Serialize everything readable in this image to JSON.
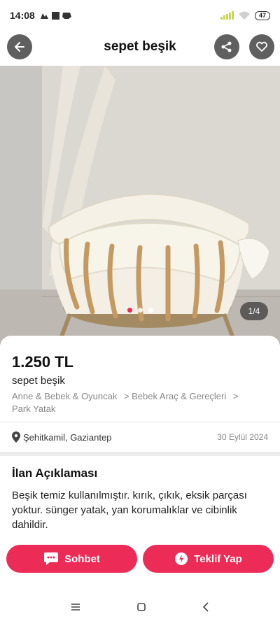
{
  "status_bar": {
    "time": "14:08",
    "battery": "47"
  },
  "header": {
    "title": "sepet beşik",
    "back_icon": "arrow-left-icon",
    "share_icon": "share-icon",
    "favorite_icon": "heart-icon"
  },
  "gallery": {
    "counter": "1/4",
    "total_images": 4,
    "active_index": 1,
    "dots_visible": 3
  },
  "listing": {
    "price": "1.250 TL",
    "title": "sepet beşik",
    "breadcrumb": [
      "Anne & Bebek & Oyuncak",
      "> Bebek Araç & Gereçleri",
      ">",
      "Park Yatak"
    ],
    "location": "Şehitkamil, Gaziantep",
    "date": "30 Eylül 2024",
    "description_title": "İlan Açıklaması",
    "description": "Beşik temiz kullanılmıştır. kırık, çıkık, eksik parçası yoktur. sünger yatak, yan korumalıklar ve cibinlik dahildir."
  },
  "actions": {
    "chat_label": "Sohbet",
    "offer_label": "Teklif Yap"
  },
  "colors": {
    "accent": "#ec2b57",
    "header_button": "#5f5f5f"
  }
}
